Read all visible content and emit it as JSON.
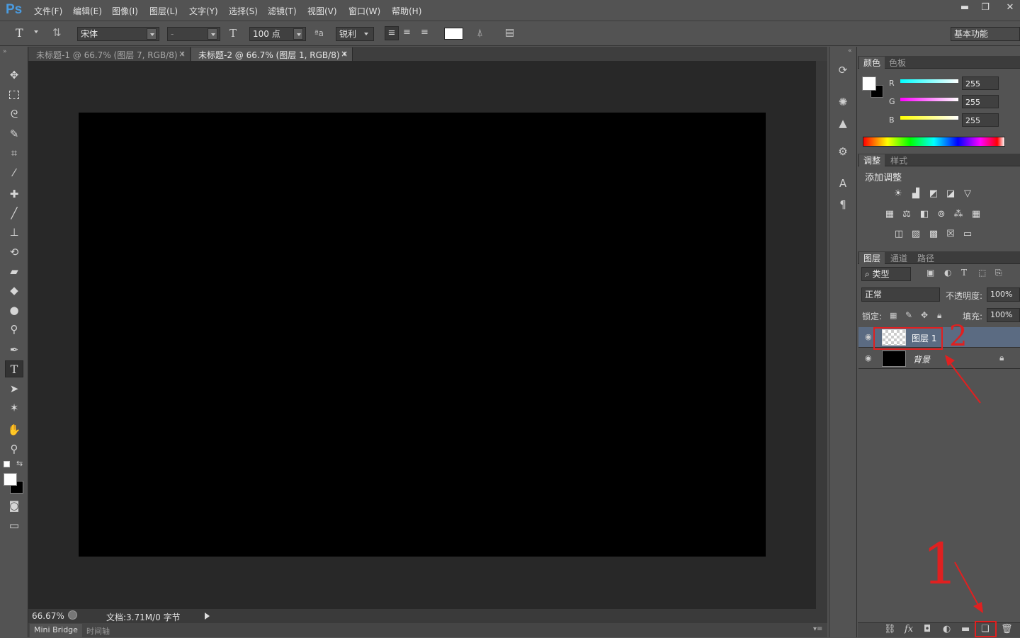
{
  "app": {
    "logo": "Ps"
  },
  "menu": [
    "文件(F)",
    "编辑(E)",
    "图像(I)",
    "图层(L)",
    "文字(Y)",
    "选择(S)",
    "滤镜(T)",
    "视图(V)",
    "窗口(W)",
    "帮助(H)"
  ],
  "window_controls": {
    "minimize": "▬",
    "restore": "❐",
    "close": "✕"
  },
  "options": {
    "font_family": "宋体",
    "font_style": "-",
    "font_size": "100 点",
    "antialias": "锐利",
    "workspace": "基本功能",
    "text_color": "#ffffff"
  },
  "tabs": [
    {
      "label": "未标题-1 @ 66.7% (图层 7, RGB/8) *",
      "close": "×"
    },
    {
      "label": "未标题-2 @ 66.7% (图层 1, RGB/8) *",
      "close": "×"
    }
  ],
  "status": {
    "zoom": "66.67%",
    "doc": "文档:3.71M/0 字节"
  },
  "bottom_tabs": [
    "Mini Bridge",
    "时间轴"
  ],
  "color_panel": {
    "tabs": [
      "颜色",
      "色板"
    ],
    "channels": [
      {
        "label": "R",
        "value": "255"
      },
      {
        "label": "G",
        "value": "255"
      },
      {
        "label": "B",
        "value": "255"
      }
    ]
  },
  "adjust_panel": {
    "tabs": [
      "调整",
      "样式"
    ],
    "title": "添加调整"
  },
  "layers_panel": {
    "tabs": [
      "图层",
      "通道",
      "路径"
    ],
    "filter": "类型",
    "blend_mode": "正常",
    "opacity_label": "不透明度:",
    "opacity": "100%",
    "lock_label": "锁定:",
    "fill_label": "填充:",
    "fill": "100%",
    "layers": [
      {
        "name": "图层 1",
        "selected": true
      },
      {
        "name": "背景",
        "locked": true
      }
    ]
  },
  "annotations": [
    "1",
    "2"
  ],
  "colors": {
    "accent": "#4a9be0",
    "annotation_red": "#e02020",
    "selected_layer": "#5b6b82"
  }
}
